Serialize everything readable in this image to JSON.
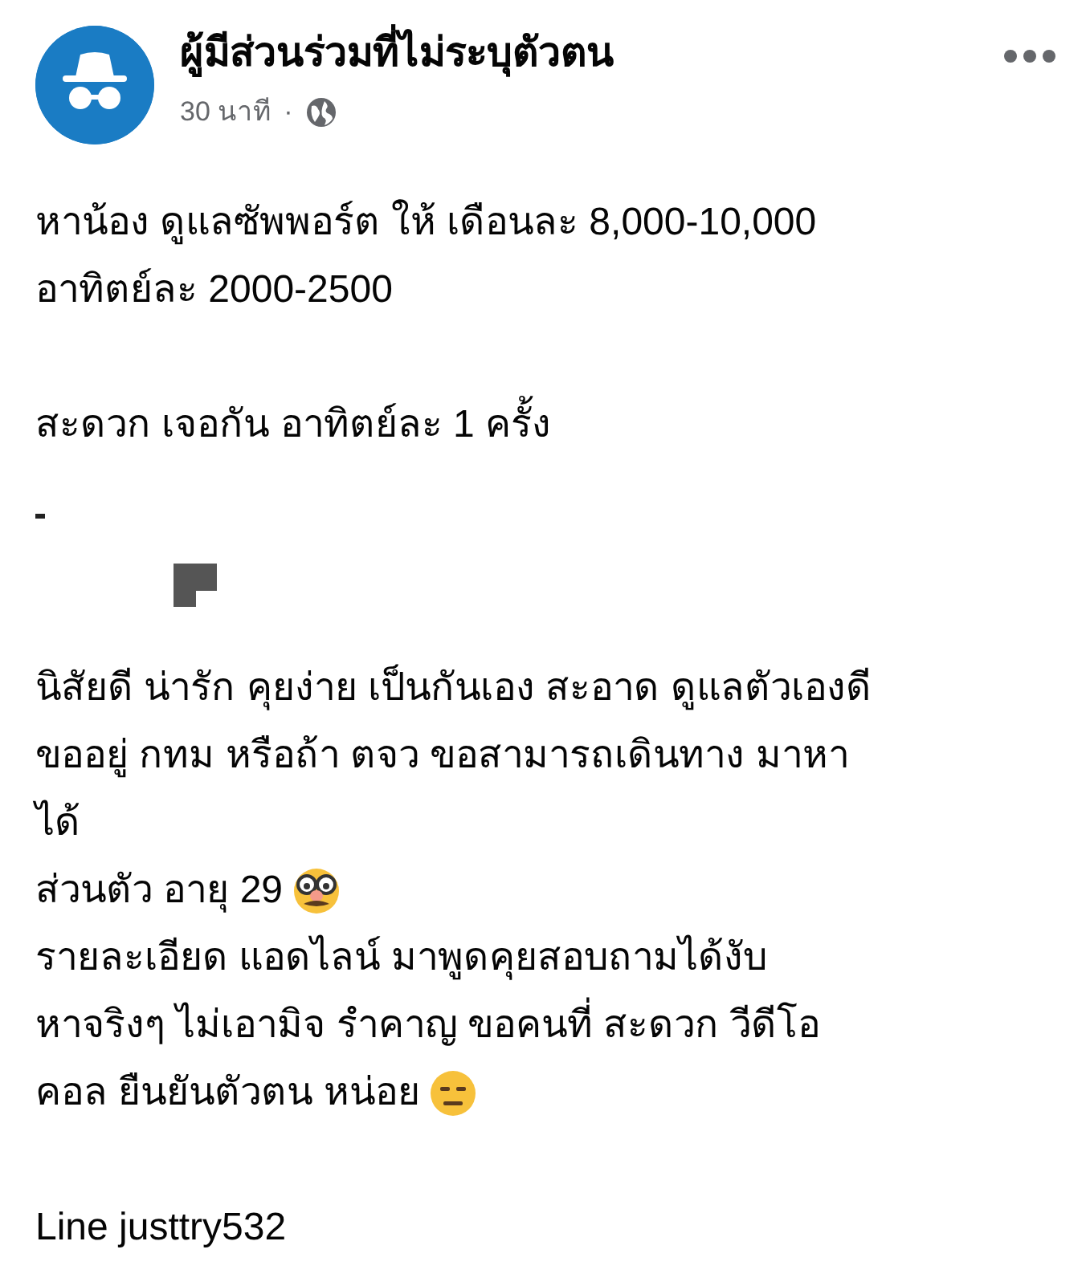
{
  "post": {
    "author": "ผู้มีส่วนร่วมที่ไม่ระบุตัวตน",
    "time": "30 นาที",
    "separator": "·",
    "paragraphs": [
      [
        {
          "text": "หาน้อง ดูแลซัพพอร์ต ให้ เดือนละ 8,000-10,000"
        },
        {
          "text": "อาทิตย์ละ 2000-2500"
        }
      ],
      [
        {
          "text": "สะดวก เจอกัน อาทิตย์ละ 1 ครั้ง"
        }
      ],
      [
        {
          "text": "นิสัยดี น่ารัก คุยง่าย เป็นกันเอง สะอาด ดูแลตัวเองดี"
        },
        {
          "text": "ขออยู่ กทม หรือถ้า ตจว ขอสามารถเดินทาง มาหา"
        },
        {
          "text": "ได้"
        },
        {
          "text": "ส่วนตัว อายุ 29",
          "kind": "emoji-line"
        },
        {
          "text": "รายละเอียด แอดไลน์ มาพูดคุยสอบถามได้งับ"
        },
        {
          "text": "หาจริงๆ ไม่เอามิจ รำคาญ ขอคนที่ สะดวก วีดีโอ"
        },
        {
          "text": "คอล ยืนยันตัวตน หน่อย",
          "kind": "emoji-line"
        }
      ],
      [
        {
          "text": "Line justtry532"
        }
      ]
    ]
  }
}
